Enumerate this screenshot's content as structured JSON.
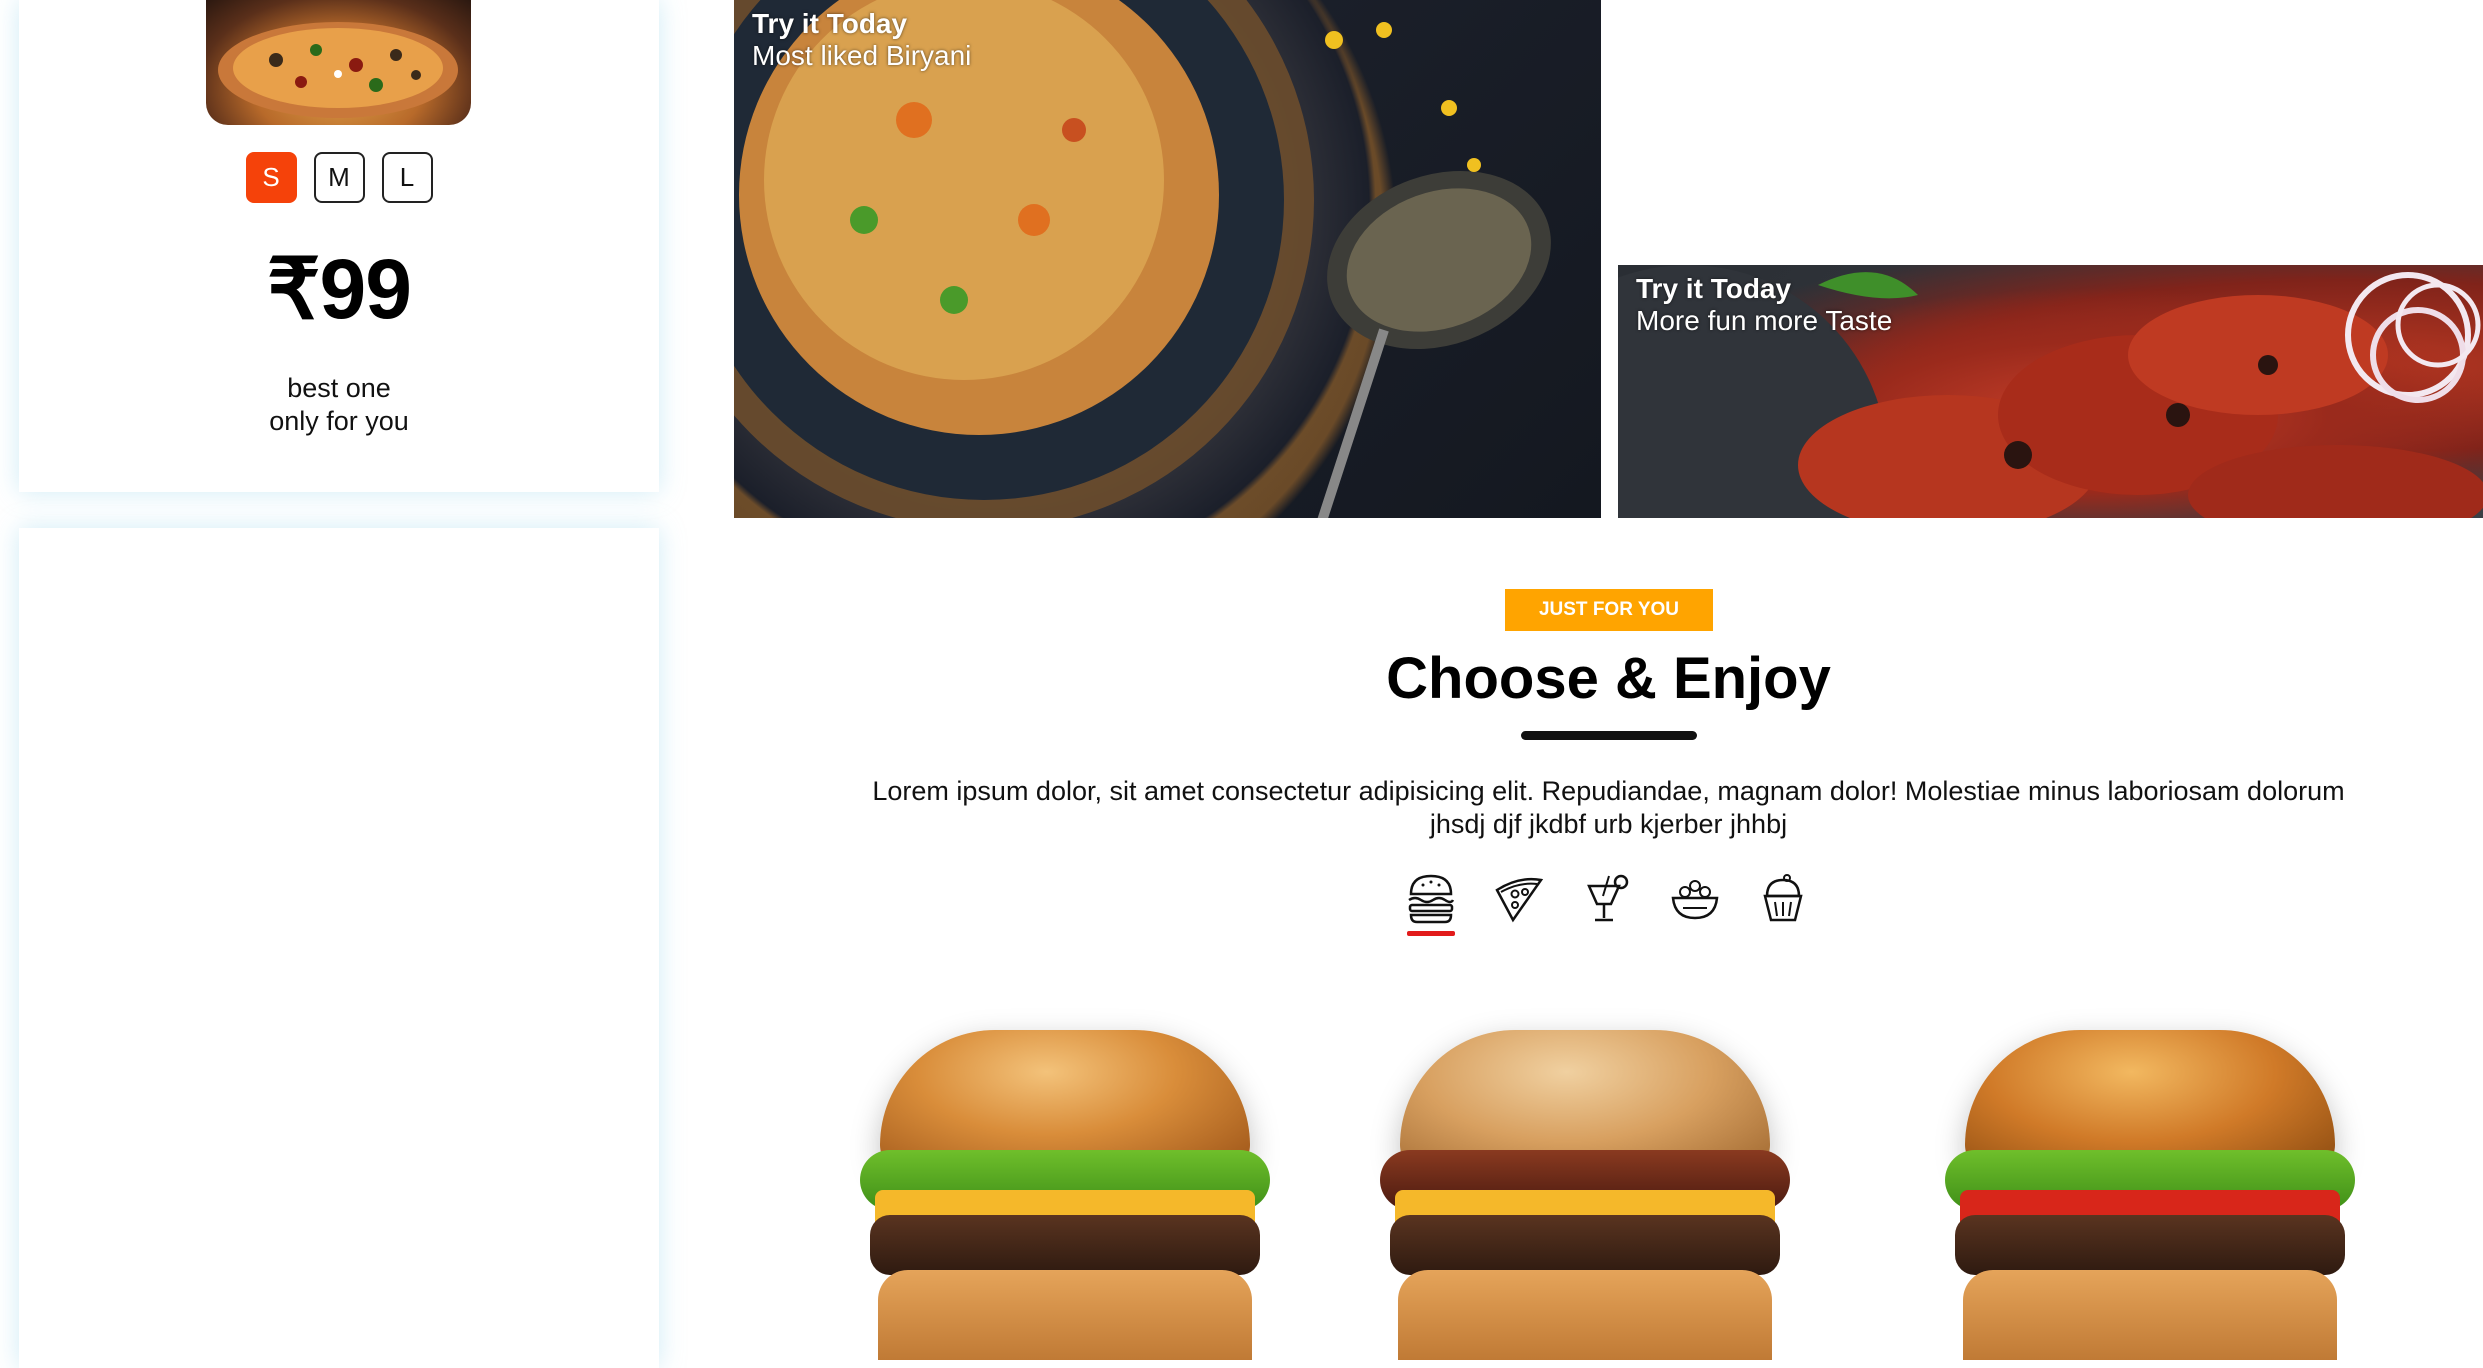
{
  "product_card": {
    "sizes": [
      {
        "label": "S",
        "active": true
      },
      {
        "label": "M",
        "active": false
      },
      {
        "label": "L",
        "active": false
      }
    ],
    "price": "₹99",
    "desc_line1": "best one",
    "desc_line2": "only for you"
  },
  "banners": {
    "biryani": {
      "title": "Try it Today",
      "subtitle": "Most liked Biryani"
    },
    "chicken": {
      "title": "Try it Today",
      "subtitle": "More fun more Taste"
    }
  },
  "section": {
    "tag": "JUST FOR YOU",
    "heading": "Choose & Enjoy",
    "lead_line1": "Lorem ipsum dolor, sit amet consectetur adipisicing elit. Repudiandae, magnam dolor! Molestiae minus laboriosam dolorum",
    "lead_line2": "jhsdj djf jkdbf urb kjerber jhhbj"
  },
  "categories": [
    {
      "icon": "burger-icon",
      "active": true
    },
    {
      "icon": "pizza-icon",
      "active": false
    },
    {
      "icon": "drink-icon",
      "active": false
    },
    {
      "icon": "salad-bowl-icon",
      "active": false
    },
    {
      "icon": "ice-cream-icon",
      "active": false
    }
  ],
  "colors": {
    "accent_orange": "#ffa400",
    "size_active": "#f5420a",
    "category_underline": "#e21b1b"
  }
}
